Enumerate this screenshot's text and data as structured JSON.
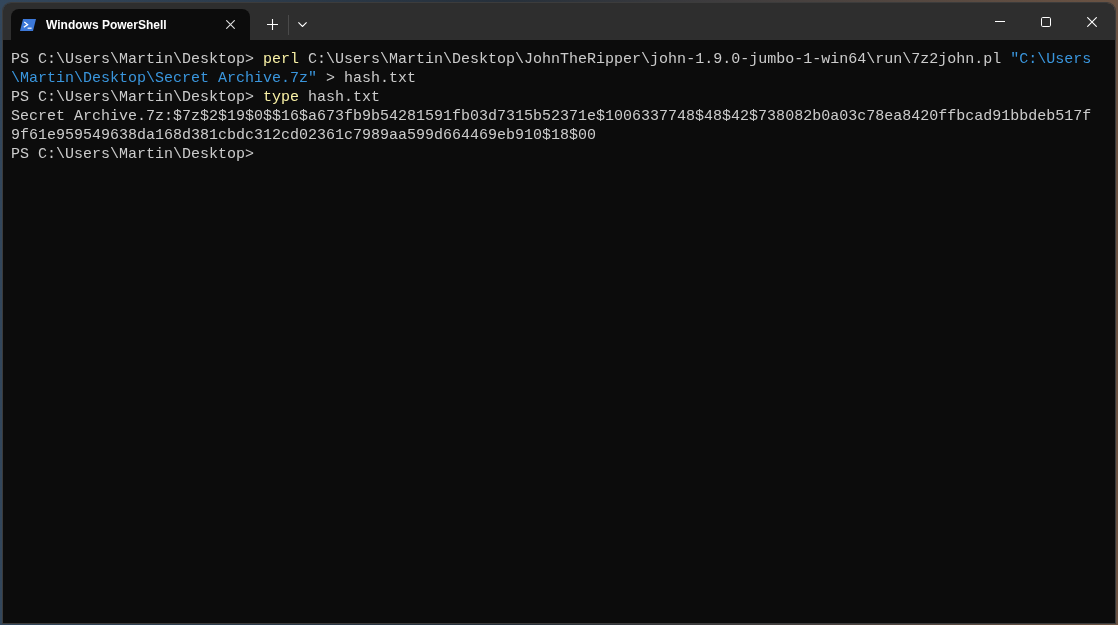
{
  "window": {
    "tabs": [
      {
        "title": "Windows PowerShell",
        "selected": true
      }
    ]
  },
  "terminal": {
    "lines": [
      {
        "segments": [
          {
            "kind": "plain",
            "text": "PS C:\\Users\\Martin\\Desktop> "
          },
          {
            "kind": "command",
            "text": "perl"
          },
          {
            "kind": "plain",
            "text": " C:\\Users\\Martin\\Desktop\\JohnTheRipper\\john-1.9.0-jumbo-1-win64\\run\\7z2john.pl "
          },
          {
            "kind": "string",
            "text": "\"C:\\Users"
          }
        ]
      },
      {
        "segments": [
          {
            "kind": "string",
            "text": "\\Martin\\Desktop\\Secret Archive.7z\""
          },
          {
            "kind": "plain",
            "text": " > hash.txt"
          }
        ]
      },
      {
        "segments": [
          {
            "kind": "plain",
            "text": "PS C:\\Users\\Martin\\Desktop> "
          },
          {
            "kind": "command",
            "text": "type"
          },
          {
            "kind": "plain",
            "text": " hash.txt"
          }
        ]
      },
      {
        "segments": [
          {
            "kind": "plain",
            "text": "Secret Archive.7z:$7z$2$19$0$$16$a673fb9b54281591fb03d7315b52371e$1006337748$48$42$738082b0a03c78ea8420ffbcad91bbdeb517f"
          }
        ]
      },
      {
        "segments": [
          {
            "kind": "plain",
            "text": "9f61e959549638da168d381cbdc312cd02361c7989aa599d664469eb910$18$00"
          }
        ]
      },
      {
        "segments": [
          {
            "kind": "plain",
            "text": "PS C:\\Users\\Martin\\Desktop>"
          }
        ]
      }
    ]
  }
}
